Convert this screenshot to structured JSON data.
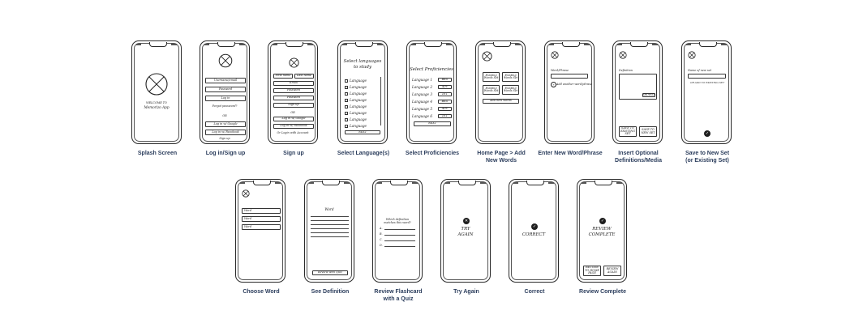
{
  "screens": {
    "splash": {
      "caption": "Splash Screen",
      "welcome": "WELCOME TO",
      "app_name": "Memorizo App"
    },
    "login": {
      "caption": "Log in/Sign up",
      "username": "Username/email",
      "password": "Password",
      "login_btn": "Log in",
      "forgot": "Forgot password?",
      "or": "OR",
      "google": "Log in w/ Google",
      "facebook": "Log in w/ Facebook",
      "signup": "Sign up"
    },
    "signup": {
      "caption": "Sign up",
      "first_name": "First name",
      "last_name": "Last name",
      "email": "Email",
      "password": "Password",
      "confirm": "Password",
      "signup_btn": "Sign up",
      "or": "OR",
      "google": "Log in w/ Google",
      "facebook": "Log in w/ Facebook",
      "account": "Or Login with Account"
    },
    "languages": {
      "caption": "Select Language(s)",
      "title_1": "Select languages",
      "title_2": "to study",
      "items": [
        "Language",
        "Language",
        "Language",
        "Language",
        "Language",
        "Language",
        "Language",
        "Language"
      ],
      "next": "NEXT"
    },
    "proficiencies": {
      "caption": "Select Proficiencies",
      "title": "Select Proficiencies",
      "items": [
        {
          "label": "Language 1",
          "level": "BEG"
        },
        {
          "label": "Language 2",
          "level": "ADV"
        },
        {
          "label": "Language 3",
          "level": "INT"
        },
        {
          "label": "Language 4",
          "level": "BEG"
        },
        {
          "label": "Language 5",
          "level": "ADV"
        },
        {
          "label": "Language 6",
          "level": "INT"
        }
      ],
      "next": "NEXT"
    },
    "home": {
      "caption_1": "Home Page > Add",
      "caption_2": "New Words",
      "sets": [
        "Existing Words Set",
        "Existing Words Set",
        "Existing Words Set",
        "Existing Words Set"
      ],
      "add": "Add new words"
    },
    "enter_word": {
      "caption": "Enter New Word/Phrase",
      "label": "Word/Phrase",
      "add_another": "Add another word/phrase"
    },
    "definitions": {
      "caption_1": "Insert Optional",
      "caption_2": "Definitions/Media",
      "label": "Definition",
      "browse": "BROWSE",
      "save_existing": "SAVE TO EXISTING SET",
      "save_new": "SAVE TO NEW SET"
    },
    "save_set": {
      "caption_1": "Save to New Set",
      "caption_2": "(or Existing Set)",
      "label": "Name of new set",
      "hint": "OR ADD TO EXISTING SET"
    },
    "choose_word": {
      "caption": "Choose Word",
      "words": [
        "Word",
        "Word",
        "Word"
      ]
    },
    "see_definition": {
      "caption": "See Definition",
      "title": "Word",
      "review": "Review with Quiz"
    },
    "quiz": {
      "caption_1": "Review Flashcard",
      "caption_2": "with a Quiz",
      "question_1": "Which definition",
      "question_2": "matches this word?",
      "options": [
        "A.",
        "B.",
        "C.",
        "D."
      ]
    },
    "try_again": {
      "caption": "Try Again",
      "line_1": "TRY",
      "line_2": "AGAIN"
    },
    "correct": {
      "caption": "Correct",
      "text": "CORRECT"
    },
    "complete": {
      "caption": "Review Complete",
      "line_1": "REVIEW",
      "line_2": "COMPLETE",
      "btn_1": "RETURN TO HOME PAGE",
      "btn_2": "REVIEW AGAIN"
    }
  },
  "colors": {
    "caption": "#2c3e5d",
    "ink": "#222222"
  }
}
